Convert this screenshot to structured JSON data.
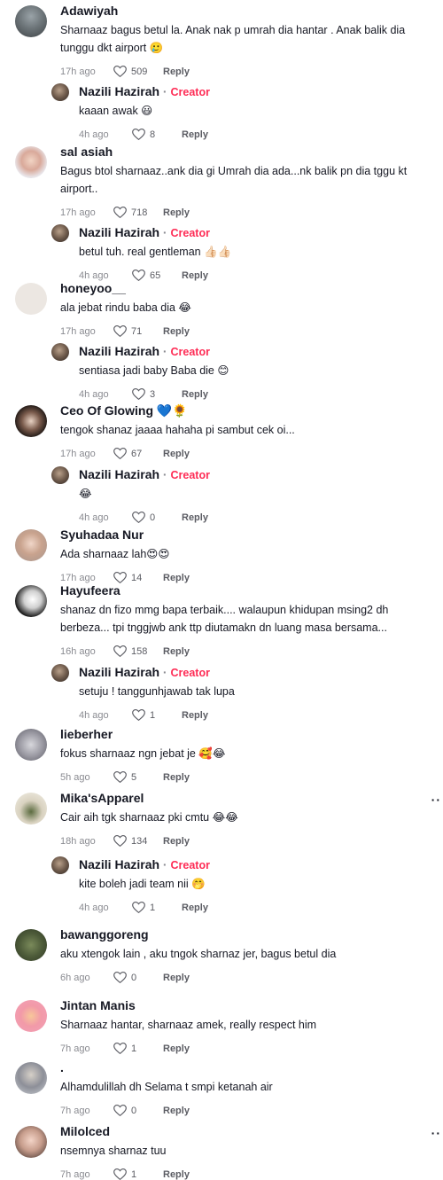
{
  "comments": [
    {
      "avatar": "avatar-adawiyah",
      "name": "Adawiyah",
      "text": "Sharnaaz bagus betul la. Anak nak p umrah dia hantar . Anak balik dia tunggu dkt airport 🥲",
      "time": "17h ago",
      "likes": "509",
      "reply": "Reply"
    },
    {
      "avatar": "avatar-nazili",
      "name": "Nazili Hazirah",
      "creator": "Creator",
      "text": "kaaan awak 😃",
      "time": "4h ago",
      "likes": "8",
      "reply": "Reply"
    },
    {
      "avatar": "avatar-salasiah",
      "name": "sal asiah",
      "text": "Bagus btol sharnaaz..ank dia gi Umrah dia ada...nk balik pn dia tggu kt airport..",
      "time": "17h ago",
      "likes": "718",
      "reply": "Reply"
    },
    {
      "avatar": "avatar-nazili",
      "name": "Nazili Hazirah",
      "creator": "Creator",
      "text": "betul tuh. real gentleman 👍🏻👍🏻",
      "time": "4h ago",
      "likes": "65",
      "reply": "Reply"
    },
    {
      "avatar": "avatar-honeyoo",
      "name": "honeyoo__",
      "text": "ala jebat rindu baba dia 😂",
      "time": "17h ago",
      "likes": "71",
      "reply": "Reply"
    },
    {
      "avatar": "avatar-nazili",
      "name": "Nazili Hazirah",
      "creator": "Creator",
      "text": "sentiasa jadi baby Baba die 😊",
      "time": "4h ago",
      "likes": "3",
      "reply": "Reply"
    },
    {
      "avatar": "avatar-ceo",
      "name": "Ceo Of Glowing 💙🌻",
      "text": "tengok shanaz jaaaa hahaha pi sambut cek oi...",
      "time": "17h ago",
      "likes": "67",
      "reply": "Reply"
    },
    {
      "avatar": "avatar-nazili",
      "name": "Nazili Hazirah",
      "creator": "Creator",
      "text": "😂",
      "time": "4h ago",
      "likes": "0",
      "reply": "Reply"
    },
    {
      "avatar": "avatar-syuhadaa",
      "name": "Syuhadaa Nur",
      "text": "Ada sharnaaz lah😍😍",
      "time": "17h ago",
      "likes": "14",
      "reply": "Reply"
    },
    {
      "avatar": "avatar-hayufeera",
      "name": "Hayufeera",
      "text": "shanaz dn fizo mmg bapa terbaik.... walaupun khidupan msing2 dh berbeza... tpi tnggjwb ank ttp diutamakn dn luang masa bersama...",
      "time": "16h ago",
      "likes": "158",
      "reply": "Reply"
    },
    {
      "avatar": "avatar-nazili",
      "name": "Nazili Hazirah",
      "creator": "Creator",
      "text": "setuju ! tanggunhjawab tak lupa",
      "time": "4h ago",
      "likes": "1",
      "reply": "Reply"
    },
    {
      "avatar": "avatar-lieberher",
      "name": "lieberher",
      "text": "fokus sharnaaz ngn jebat je 🥰😂",
      "time": "5h ago",
      "likes": "5",
      "reply": "Reply"
    },
    {
      "avatar": "avatar-mika",
      "name": "Mika'sApparel",
      "text": "Cair aih tgk sharnaaz pki cmtu 😂😂",
      "time": "18h ago",
      "likes": "134",
      "reply": "Reply"
    },
    {
      "avatar": "avatar-nazili",
      "name": "Nazili Hazirah",
      "creator": "Creator",
      "text": "kite boleh jadi team nii 🤭",
      "time": "4h ago",
      "likes": "1",
      "reply": "Reply"
    },
    {
      "avatar": "avatar-bawang",
      "name": "bawanggoreng",
      "text": "aku xtengok lain , aku tngok sharnaz jer, bagus betul dia",
      "time": "6h ago",
      "likes": "0",
      "reply": "Reply"
    },
    {
      "avatar": "avatar-jintan",
      "name": "Jintan Manis",
      "text": "Sharnaaz hantar, sharnaaz amek, really respect him",
      "time": "7h ago",
      "likes": "1",
      "reply": "Reply"
    },
    {
      "avatar": "avatar-dot",
      "name": ".",
      "text": "Alhamdulillah dh Selama t smpi ketanah air",
      "time": "7h ago",
      "likes": "0",
      "reply": "Reply"
    },
    {
      "avatar": "avatar-milolced",
      "name": "Milolced",
      "text": "nsemnya sharnaz tuu",
      "time": "7h ago",
      "likes": "1",
      "reply": "Reply"
    }
  ],
  "more_label": "··"
}
